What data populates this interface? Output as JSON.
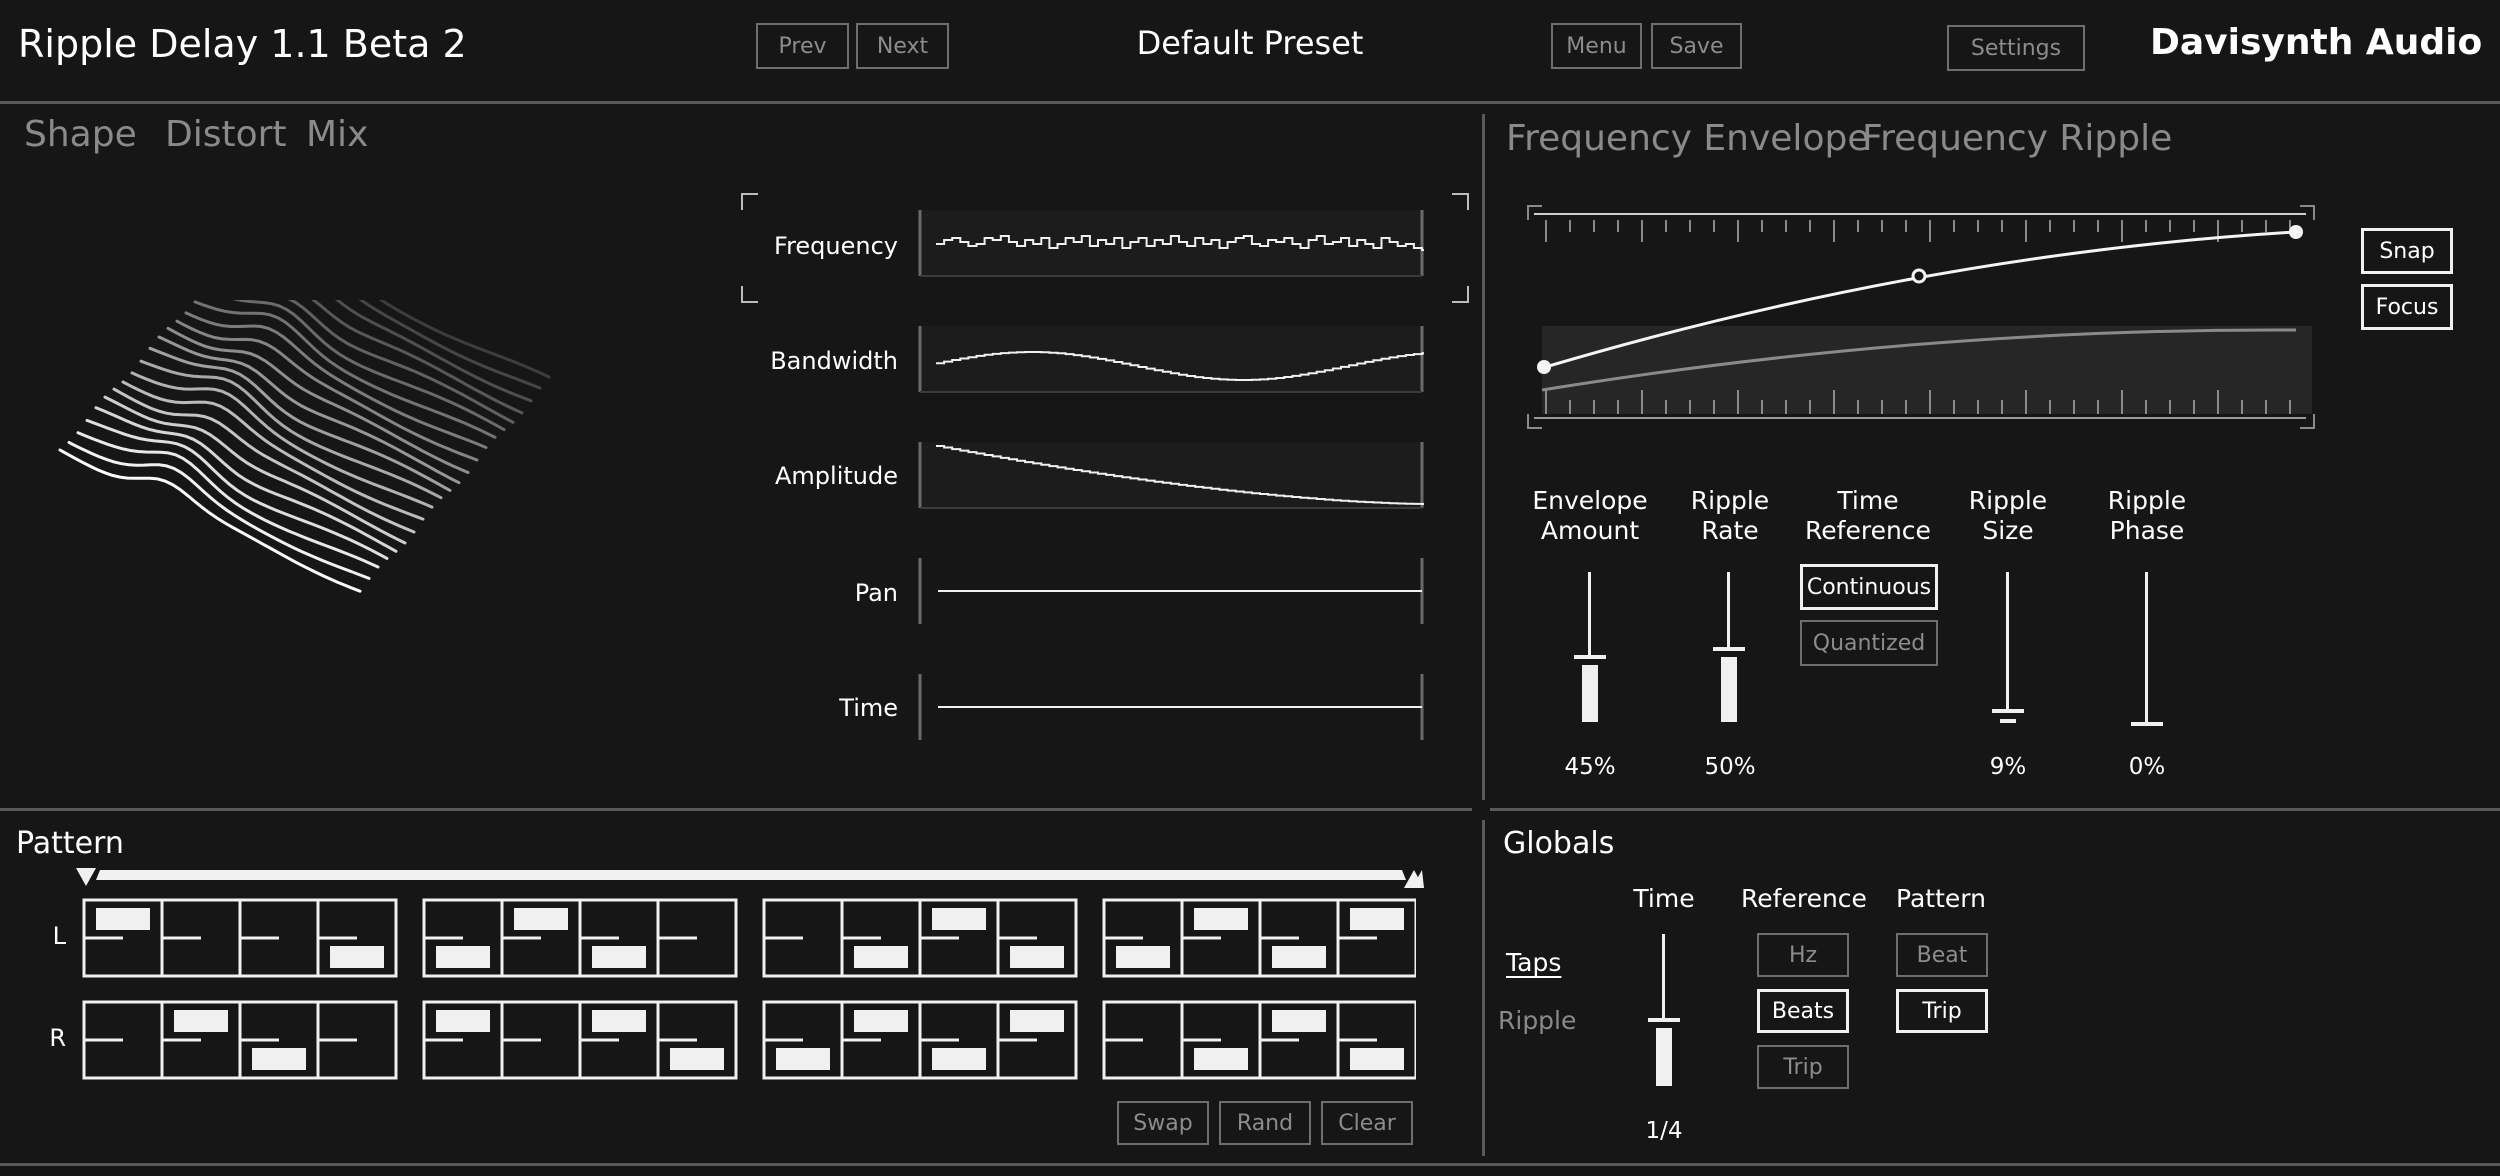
{
  "header": {
    "title": "Ripple Delay 1.1 Beta 2",
    "prev_label": "Prev",
    "next_label": "Next",
    "preset_name": "Default Preset",
    "menu_label": "Menu",
    "save_label": "Save",
    "settings_label": "Settings",
    "brand": "Davisynth Audio"
  },
  "left_tabs": [
    {
      "label": "Shape",
      "selected": true
    },
    {
      "label": "Distort",
      "selected": false
    },
    {
      "label": "Mix",
      "selected": false
    }
  ],
  "shape_rows": [
    {
      "label": "Frequency",
      "selected": true
    },
    {
      "label": "Bandwidth",
      "selected": false
    },
    {
      "label": "Amplitude",
      "selected": false
    },
    {
      "label": "Pan",
      "selected": false
    },
    {
      "label": "Time",
      "selected": false
    }
  ],
  "right_tabs": [
    {
      "label": "Frequency Envelope",
      "selected": false
    },
    {
      "label": "Frequency Ripple",
      "selected": true
    }
  ],
  "envelope_buttons": {
    "snap": "Snap",
    "focus": "Focus"
  },
  "ripple_controls": {
    "envelope_amount": {
      "label_1": "Envelope",
      "label_2": "Amount",
      "value": "45%",
      "level": 0.45
    },
    "ripple_rate": {
      "label_1": "Ripple",
      "label_2": "Rate",
      "value": "50%",
      "level": 0.5
    },
    "time_reference": {
      "label_1": "Time",
      "label_2": "Reference",
      "options": [
        "Continuous",
        "Quantized"
      ],
      "selected": "Continuous"
    },
    "ripple_size": {
      "label_1": "Ripple",
      "label_2": "Size",
      "value": "9%",
      "level": 0.09
    },
    "ripple_phase": {
      "label_1": "Ripple",
      "label_2": "Phase",
      "value": "0%",
      "level": 0.0
    }
  },
  "pattern": {
    "title": "Pattern",
    "row_labels": [
      "L",
      "R"
    ],
    "swap_label": "Swap",
    "rand_label": "Rand",
    "clear_label": "Clear"
  },
  "globals": {
    "title": "Globals",
    "taps_label": "Taps",
    "ripple_label": "Ripple",
    "time_header": "Time",
    "time_value": "1/4",
    "time_level": 0.45,
    "reference_header": "Reference",
    "reference_options": [
      "Hz",
      "Beats",
      "Trip"
    ],
    "reference_selected": "Beats",
    "pattern_header": "Pattern",
    "pattern_options": [
      "Beat",
      "Trip"
    ],
    "pattern_selected": "Trip"
  },
  "colors": {
    "background": "#161616",
    "foreground": "#ffffff",
    "muted": "#8c8c8c",
    "divider": "#5a5a5a"
  }
}
